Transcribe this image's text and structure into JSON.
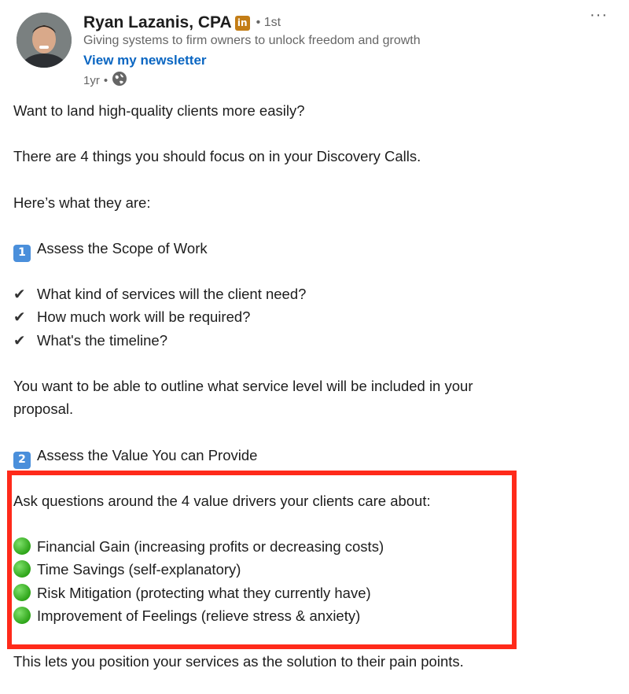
{
  "author": {
    "name": "Ryan Lazanis, CPA",
    "badge": "in",
    "degree": "• 1st",
    "headline": "Giving systems to firm owners to unlock freedom and growth",
    "newsletter_link": "View my newsletter",
    "time": "1yr",
    "time_sep": "•",
    "visibility_icon": "globe-icon"
  },
  "menu_label": "···",
  "post": {
    "intro": "Want to land high-quality clients more easily?",
    "line2": "There are 4 things you should focus on in your Discovery Calls.",
    "line3": "Here’s what they are:",
    "item1_num": "1",
    "item1_title": "Assess the Scope of Work",
    "check1": "What kind of services will the client need?",
    "check2": "How much work will be required?",
    "check3": "What's the timeline?",
    "para1_line1": "You want to be able to outline what service level will be included in your",
    "para1_line2": "proposal.",
    "item2_num": "2",
    "item2_title": "Assess the Value You can Provide",
    "drivers_intro": "Ask questions around the 4 value drivers your clients care about:",
    "driver1": "Financial Gain (increasing profits or decreasing costs)",
    "driver2": "Time Savings (self-explanatory)",
    "driver3": "Risk Mitigation (protecting what they currently have)",
    "driver4": "Improvement of Feelings (relieve stress & anxiety)",
    "closing": "This lets you position your services as the solution to their pain points.",
    "check_glyph": "✔"
  },
  "colors": {
    "link": "#0a66c2",
    "highlight_border": "#ff2a1a",
    "badge": "#c37d16",
    "keycap": "#4a8fdb",
    "bullet_green": "#2ea519"
  }
}
